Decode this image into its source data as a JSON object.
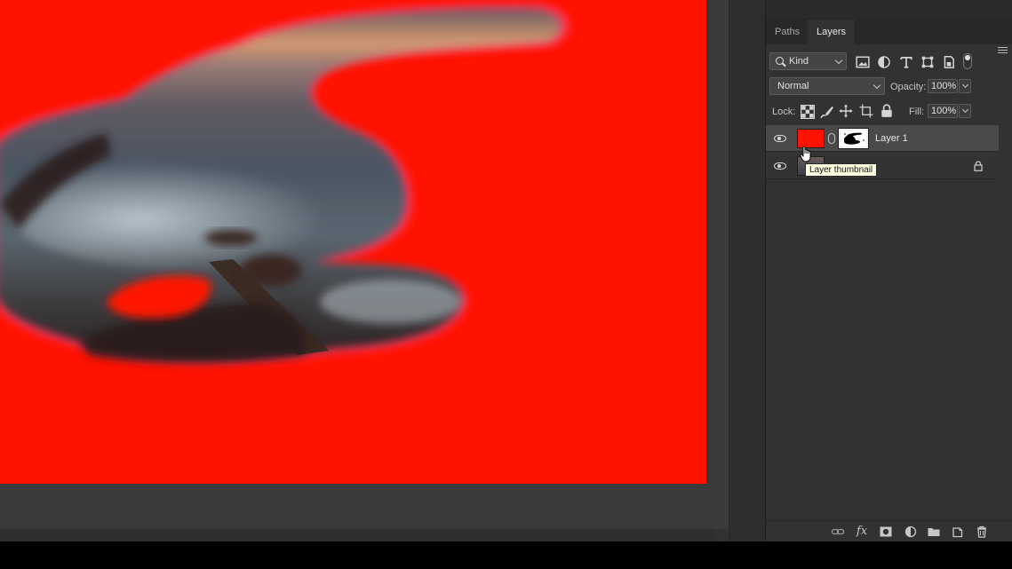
{
  "panel": {
    "tabs": [
      {
        "label": "Paths",
        "active": false
      },
      {
        "label": "Layers",
        "active": true
      }
    ],
    "filter": {
      "kind_label": "Kind"
    },
    "blend": {
      "mode": "Normal"
    },
    "opacity": {
      "label": "Opacity:",
      "value": "100%"
    },
    "lock": {
      "label": "Lock:"
    },
    "fill": {
      "label": "Fill:",
      "value": "100%"
    },
    "layers": [
      {
        "name": "Layer 1",
        "selected": true,
        "visible": true,
        "has_mask": true
      },
      {
        "name": "",
        "selected": false,
        "visible": true,
        "locked": true
      }
    ],
    "tooltip": "Layer thumbnail"
  },
  "colors": {
    "fill_red": "#ff1200",
    "panel_bg": "#323232",
    "selected_row": "#4a4a4a",
    "tooltip_bg": "#ffffe1"
  },
  "icons": {
    "filter": [
      "image-filter-icon",
      "adjustment-filter-icon",
      "type-filter-icon",
      "shape-filter-icon",
      "smart-object-filter-icon"
    ],
    "lock": [
      "lock-transparent-icon",
      "lock-image-icon",
      "lock-position-icon",
      "lock-artboard-icon",
      "lock-all-icon"
    ],
    "bottom": [
      "link-layers-icon",
      "fx-icon",
      "add-mask-icon",
      "new-adjustment-icon",
      "new-group-icon",
      "new-layer-icon",
      "trash-icon"
    ]
  }
}
